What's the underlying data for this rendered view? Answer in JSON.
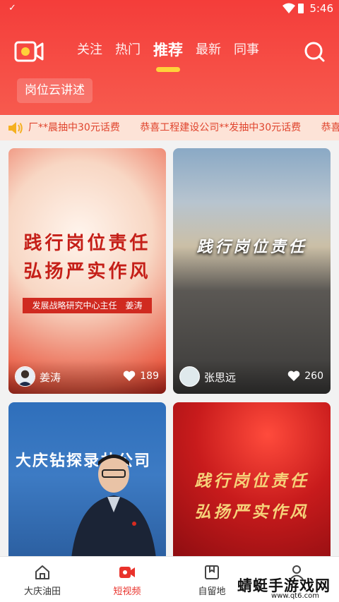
{
  "status": {
    "time": "5:46"
  },
  "header": {
    "tabs": [
      {
        "label": "关注"
      },
      {
        "label": "热门"
      },
      {
        "label": "推荐",
        "active": true
      },
      {
        "label": "最新"
      },
      {
        "label": "同事"
      }
    ],
    "chip_label": "岗位云讲述"
  },
  "notice": {
    "items": [
      "厂**晨抽中30元话费",
      "恭喜工程建设公司**发抽中30元话费",
      "恭喜"
    ]
  },
  "cards": [
    {
      "title_lines": [
        "践行岗位责任",
        "弘扬严实作风"
      ],
      "caption": "发展战略研究中心主任　姜涛",
      "author": "姜涛",
      "likes": "189"
    },
    {
      "title_lines": [
        "践行岗位责任"
      ],
      "author": "张思远",
      "likes": "260"
    },
    {
      "banner": "大庆钻探录井公司"
    },
    {
      "title_lines": [
        "践行岗位责任",
        "弘扬严实作风"
      ]
    }
  ],
  "bottom_nav": [
    {
      "label": "大庆油田",
      "icon": "home-icon"
    },
    {
      "label": "短视频",
      "icon": "video-camera-icon",
      "active": true
    },
    {
      "label": "自留地",
      "icon": "bookmark-box-icon"
    },
    {
      "label": "",
      "icon": "user-icon"
    }
  ],
  "watermark": {
    "text": "蜻蜓手游戏网",
    "url": "www.qt6.com"
  },
  "colors": {
    "accent": "#f43d3a",
    "tab_indicator": "#ffd23a",
    "notice_text": "#e0442d",
    "active_nav": "#e9322b"
  }
}
